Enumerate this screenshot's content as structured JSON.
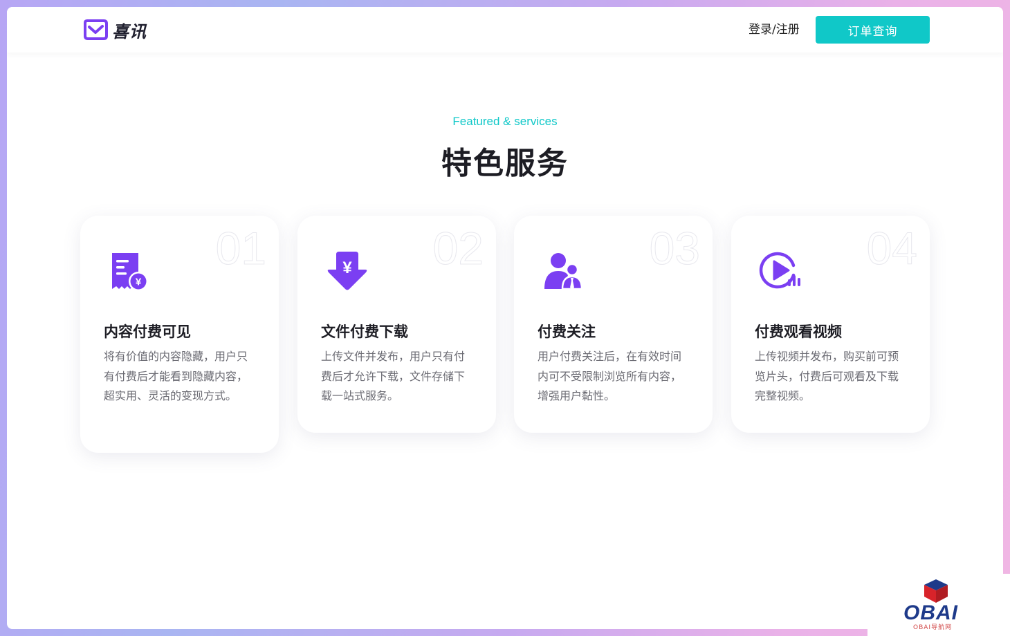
{
  "header": {
    "logo_text": "喜讯",
    "login_label": "登录/注册",
    "order_button_label": "订单查询"
  },
  "section": {
    "subtitle": "Featured & services",
    "title": "特色服务"
  },
  "cards": [
    {
      "num": "01",
      "icon": "paid-content-icon",
      "title": "内容付费可见",
      "desc": "将有价值的内容隐藏，用户只有付费后才能看到隐藏内容，超实用、灵活的变现方式。"
    },
    {
      "num": "02",
      "icon": "paid-download-icon",
      "title": "文件付费下载",
      "desc": "上传文件并发布，用户只有付费后才允许下载，文件存储下载一站式服务。"
    },
    {
      "num": "03",
      "icon": "paid-follow-icon",
      "title": "付费关注",
      "desc": "用户付费关注后，在有效时间内可不受限制浏览所有内容，增强用户黏性。"
    },
    {
      "num": "04",
      "icon": "paid-video-icon",
      "title": "付费观看视频",
      "desc": "上传视频并发布，购买前可预览片头，付费后可观看及下载完整视频。"
    }
  ],
  "watermark": {
    "brand": "OBAI",
    "caption": "OBAI导航网"
  },
  "colors": {
    "accent": "#10c8c8",
    "icon_purple": "#7b3ff2"
  }
}
